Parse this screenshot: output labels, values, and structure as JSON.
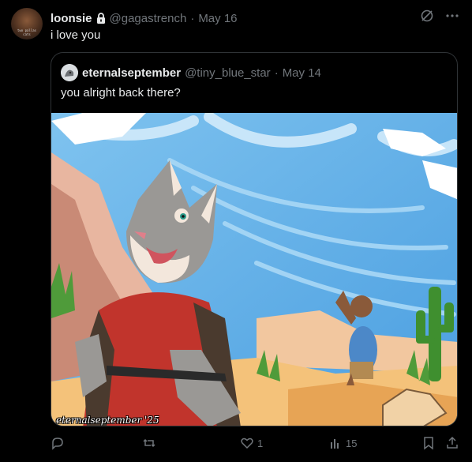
{
  "tweet": {
    "display_name": "loonsie",
    "handle": "@gagastrench",
    "separator": "·",
    "date": "May 16",
    "text": "i love you",
    "avatar_caption": "two pallas cats"
  },
  "quote": {
    "display_name": "eternalseptember",
    "handle": "@tiny_blue_star",
    "separator": "·",
    "date": "May 14",
    "text": "you alright back there?",
    "watermark": "eternalseptember '25"
  },
  "actions": {
    "reply_count": "",
    "retweet_count": "",
    "like_count": "1",
    "views_count": "15"
  },
  "colors": {
    "background": "#000000",
    "text": "#e7e9ea",
    "muted": "#71767b",
    "border": "#2f3336"
  }
}
